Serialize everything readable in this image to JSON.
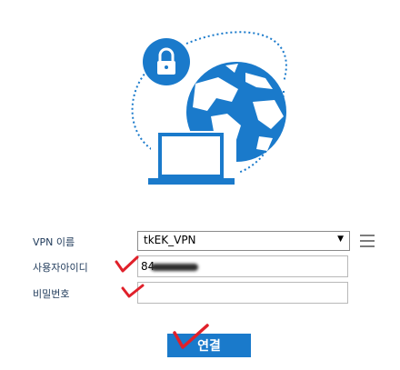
{
  "form": {
    "vpn_name_label": "VPN 이름",
    "vpn_name_value": "tkEK_VPN",
    "vpn_name_arrow": "▼",
    "user_id_label": "사용자아이디",
    "user_id_value": "84",
    "password_label": "비밀번호",
    "password_value": "",
    "connect_label": "연결"
  },
  "icons": [
    "lock-icon",
    "globe-icon",
    "laptop-icon",
    "menu-icon",
    "check-mark-icon"
  ],
  "colors": {
    "accent_blue": "#1a7acb",
    "label_text": "#1f3a5a",
    "check_red": "#e0202a"
  }
}
